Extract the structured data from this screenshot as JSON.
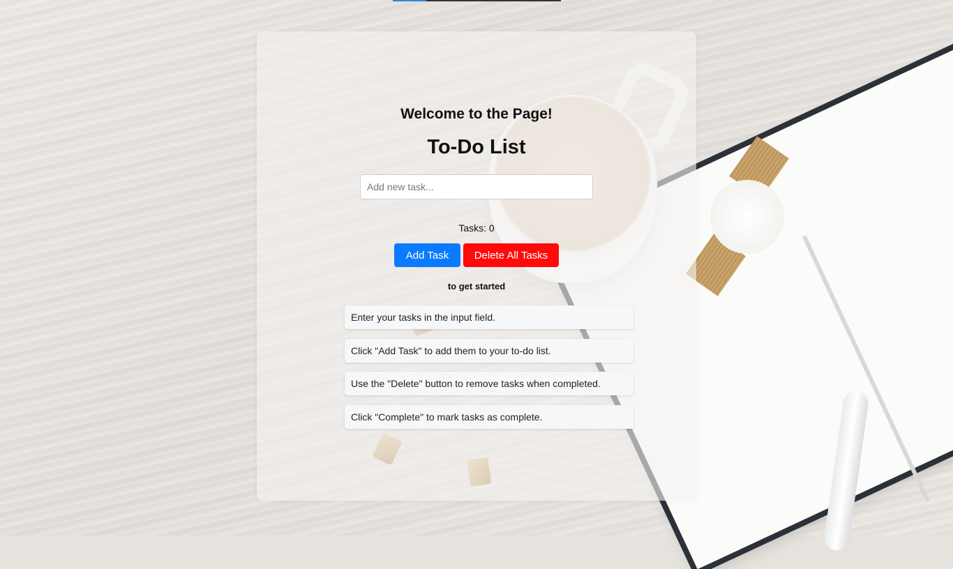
{
  "header": {
    "welcome": "Welcome to the Page!",
    "title": "To-Do List"
  },
  "task_input": {
    "placeholder": "Add new task...",
    "value": ""
  },
  "task_count": "Tasks: 0",
  "buttons": {
    "add": "Add Task",
    "delete_all": "Delete All Tasks"
  },
  "colors": {
    "add_button": "#0a7bff",
    "delete_button": "#ff0a0a"
  },
  "get_started": "to get started",
  "instructions": [
    "Enter your tasks in the input field.",
    "Click \"Add Task\" to add them to your to-do list.",
    "Use the \"Delete\" button to remove tasks when completed.",
    "Click \"Complete\" to mark tasks as complete."
  ]
}
